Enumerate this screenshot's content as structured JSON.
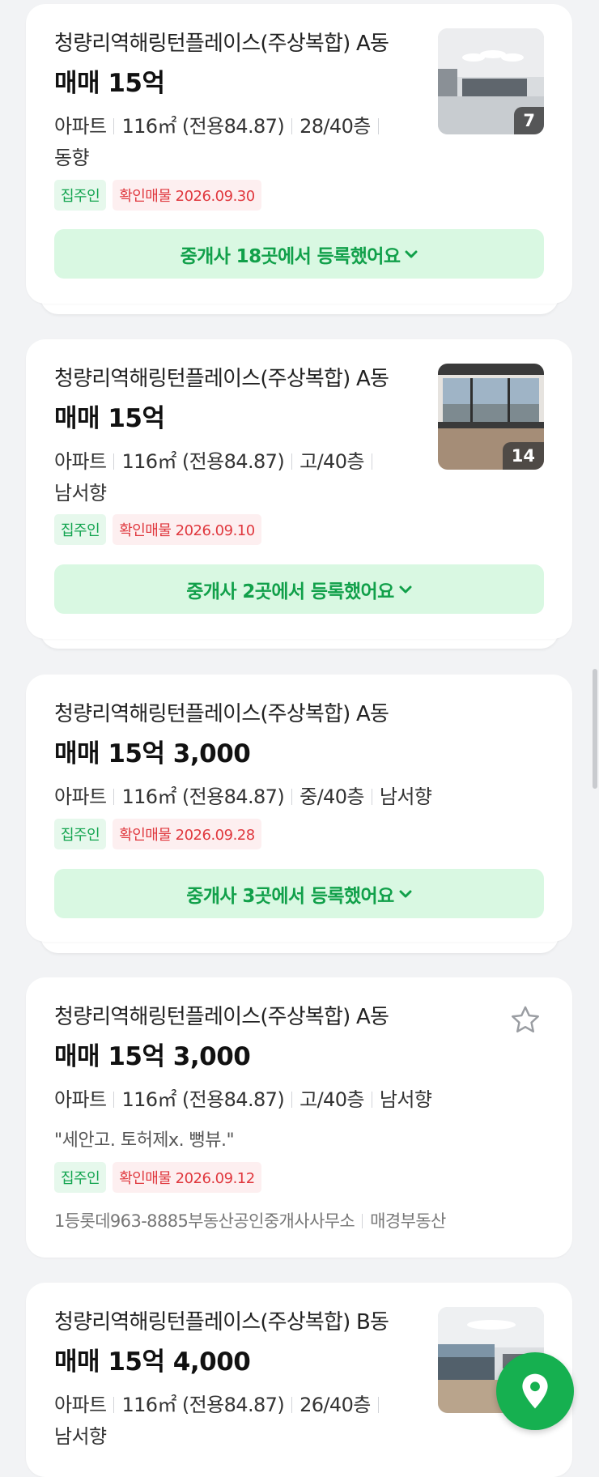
{
  "listings": [
    {
      "title": "청량리역해링턴플레이스(주상복합) A동",
      "price": "매매 15억",
      "type": "아파트",
      "area": "116㎡ (전용84.87)",
      "floor": "28/40층",
      "direction": "동향",
      "owner_tag": "집주인",
      "confirm_tag": "확인매물 2026.09.30",
      "agency_label": "중개사 18곳에서 등록했어요",
      "photo_count": "7"
    },
    {
      "title": "청량리역해링턴플레이스(주상복합) A동",
      "price": "매매 15억",
      "type": "아파트",
      "area": "116㎡ (전용84.87)",
      "floor": "고/40층",
      "direction": "남서향",
      "owner_tag": "집주인",
      "confirm_tag": "확인매물 2026.09.10",
      "agency_label": "중개사 2곳에서 등록했어요",
      "photo_count": "14"
    },
    {
      "title": "청량리역해링턴플레이스(주상복합) A동",
      "price": "매매 15억 3,000",
      "type": "아파트",
      "area": "116㎡ (전용84.87)",
      "floor": "중/40층",
      "direction": "남서향",
      "owner_tag": "집주인",
      "confirm_tag": "확인매물 2026.09.28",
      "agency_label": "중개사 3곳에서 등록했어요"
    },
    {
      "title": "청량리역해링턴플레이스(주상복합) A동",
      "price": "매매 15억 3,000",
      "type": "아파트",
      "area": "116㎡ (전용84.87)",
      "floor": "고/40층",
      "direction": "남서향",
      "description": "\"세안고. 토허제x. 뻥뷰.\"",
      "owner_tag": "집주인",
      "confirm_tag": "확인매물 2026.09.12",
      "agent_name": "1등롯데963-8885부동산공인중개사사무소",
      "agent_provider": "매경부동산"
    },
    {
      "title": "청량리역해링턴플레이스(주상복합) B동",
      "price": "매매 15억 4,000",
      "type": "아파트",
      "area": "116㎡ (전용84.87)",
      "floor": "26/40층",
      "direction": "남서향"
    }
  ],
  "colors": {
    "accent_green": "#16b050",
    "tag_red": "#e0383e",
    "background": "#f2f3f5"
  },
  "icons": {
    "expand": "chevron-down-icon",
    "favorite": "star-outline-icon",
    "map": "location-pin-icon"
  }
}
